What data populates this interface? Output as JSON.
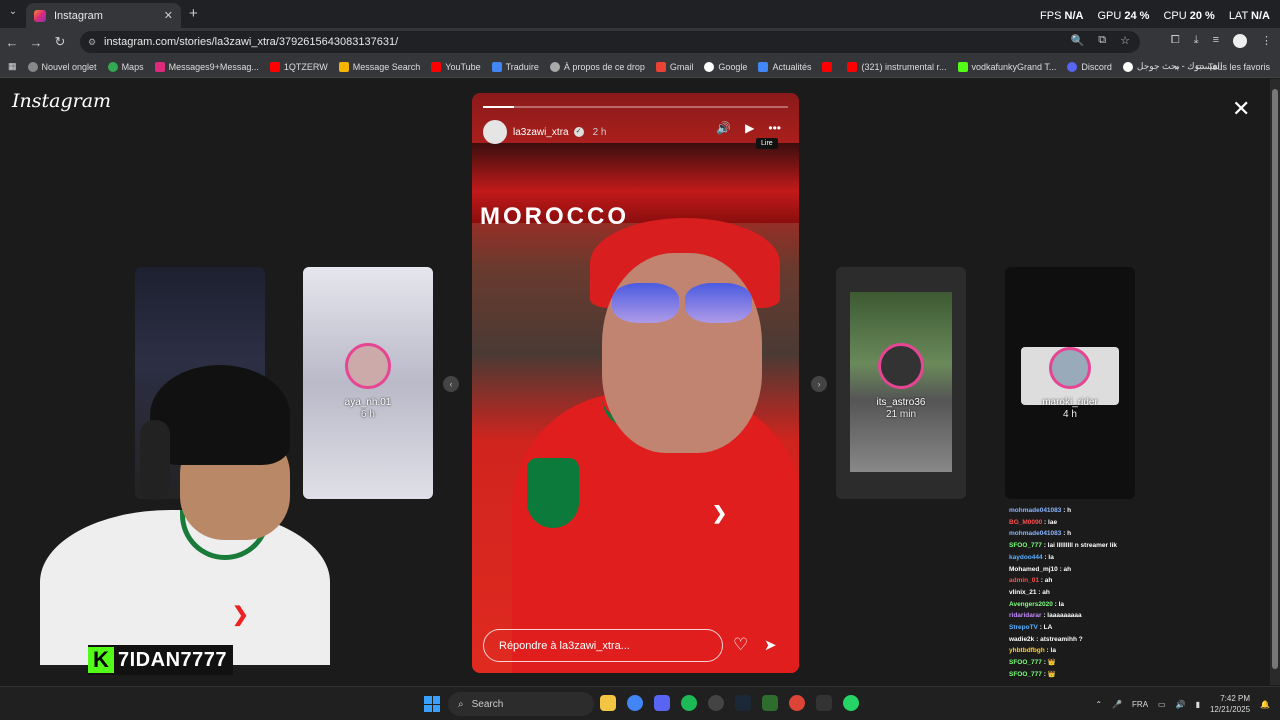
{
  "browser": {
    "tab_title": "Instagram",
    "url": "instagram.com/stories/la3zawi_xtra/3792615643083137631/",
    "stats": {
      "fps_label": "FPS",
      "fps_value": "N/A",
      "gpu_label": "GPU",
      "gpu_value": "24 %",
      "cpu_label": "CPU",
      "cpu_value": "20 %",
      "lat_label": "LAT",
      "lat_value": "N/A"
    },
    "bookmarks": [
      "Nouvel onglet",
      "Maps",
      "Messages9+Messag...",
      "1QTZERW",
      "Message Search",
      "YouTube",
      "Traduire",
      "À propos de ce drop",
      "Gmail",
      "Google",
      "Actualités",
      "(321) instrumental r...",
      "vodkafunkyGrand T...",
      "Discord",
      "الفيسبوك - بحث جوجل"
    ],
    "all_favorites": "Tous les favoris"
  },
  "instagram": {
    "logo": "Instagram",
    "story": {
      "username": "la3zawi_xtra",
      "time": "2 h",
      "tooltip": "Lire",
      "reply_placeholder": "Répondre à la3zawi_xtra...",
      "banner_text": "MOROCCO",
      "progress": 0.1
    },
    "thumbs": [
      {
        "name": "aya_nh.01",
        "time": "6 h"
      },
      {
        "name": "its_astro36",
        "time": "21 min"
      },
      {
        "name": "maroki_rider",
        "time": "4 h"
      }
    ]
  },
  "chat": [
    {
      "user": "mohmade041083",
      "msg": "h",
      "color": "#8ab4ff"
    },
    {
      "user": "BG_M0090",
      "msg": "lae",
      "color": "#ff4d4d"
    },
    {
      "user": "mohmade041083",
      "msg": "h",
      "color": "#8ab4ff"
    },
    {
      "user": "SFOO_777",
      "msg": "lai lllllllll n streamer lik",
      "color": "#7dff7d"
    },
    {
      "user": "kaydoo444",
      "msg": "la",
      "color": "#5ab0ff"
    },
    {
      "user": "Mohamed_mj10",
      "msg": "ah",
      "color": "#ffffff"
    },
    {
      "user": "admin_01",
      "msg": "ah",
      "color": "#ff4d4d"
    },
    {
      "user": "vlinix_21",
      "msg": "ah",
      "color": "#ffffff"
    },
    {
      "user": "Avengers2020",
      "msg": "la",
      "color": "#7dff7d"
    },
    {
      "user": "ridaridarar",
      "msg": "laaaaaaaaa",
      "color": "#c58aff"
    },
    {
      "user": "StrepoTV",
      "msg": "LA",
      "color": "#5ab0ff"
    },
    {
      "user": "wadie2k",
      "msg": "atstreamihh ?",
      "color": "#ffffff"
    },
    {
      "user": "yhbtbdfbgh",
      "msg": "la",
      "color": "#ffcc33"
    },
    {
      "user": "SFOO_777",
      "msg": "👑",
      "color": "#7dff7d"
    },
    {
      "user": "SFOO_777",
      "msg": "👑",
      "color": "#7dff7d"
    }
  ],
  "overlay": {
    "kick_name": "7IDAN7777"
  },
  "taskbar": {
    "search": "Search",
    "lang": "FRA",
    "time": "7:42 PM",
    "date": "12/21/2025"
  }
}
